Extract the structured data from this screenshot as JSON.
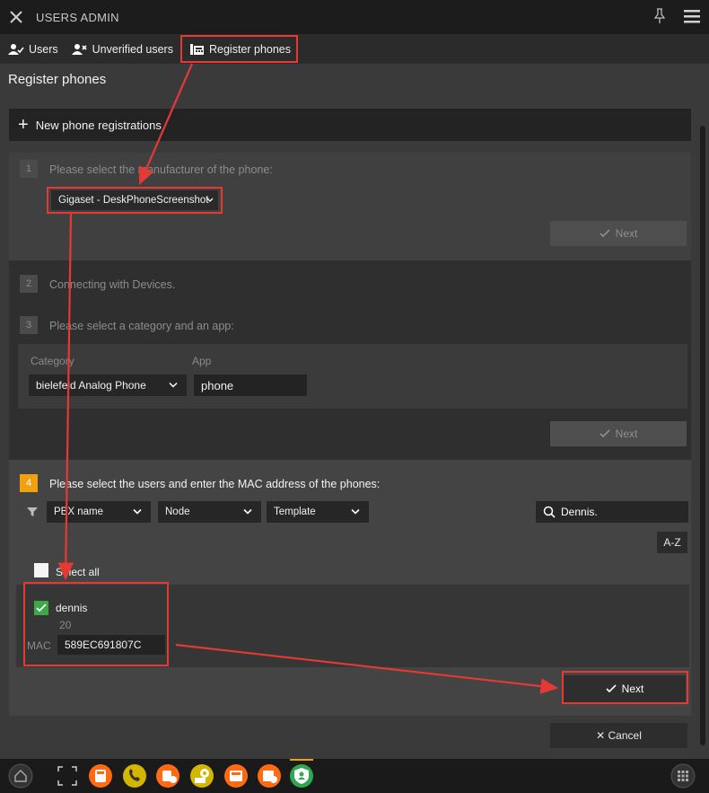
{
  "window": {
    "title": "USERS ADMIN"
  },
  "tabs": [
    {
      "label": "Users",
      "icon": "user-check-icon"
    },
    {
      "label": "Unverified users",
      "icon": "user-x-icon"
    },
    {
      "label": "Register phones",
      "icon": "phone-register-icon"
    }
  ],
  "page": {
    "title": "Register phones"
  },
  "new_registration": {
    "label": "New phone registrations"
  },
  "step1": {
    "number": "1",
    "text": "Please select the manufacturer of the phone:",
    "manufacturer_value": "Gigaset - DeskPhoneScreenshot",
    "next_label": "Next"
  },
  "step2": {
    "number": "2",
    "text": "Connecting with Devices."
  },
  "step3": {
    "number": "3",
    "text": "Please select a category and an app:",
    "category_label": "Category",
    "app_label": "App",
    "category_value": "bielefeld Analog Phone",
    "app_value": "phone",
    "next_label": "Next"
  },
  "step4": {
    "number": "4",
    "text": "Please select the users and enter the MAC address of the phones:",
    "filters": {
      "pbx": "PBX name",
      "node": "Node",
      "template": "Template"
    },
    "search_value": "Dennis.",
    "sort_label": "A-Z",
    "select_all_label": "Select all",
    "user": {
      "name": "dennis",
      "extension": "20",
      "mac_label": "MAC",
      "mac_value": "589EC691807C"
    },
    "next_label": "Next"
  },
  "cancel_label": "✕ Cancel",
  "colors": {
    "accent": "#f0a010",
    "highlight": "#e53935",
    "check": "#3fa846",
    "app_icon": "#ff6a13"
  }
}
